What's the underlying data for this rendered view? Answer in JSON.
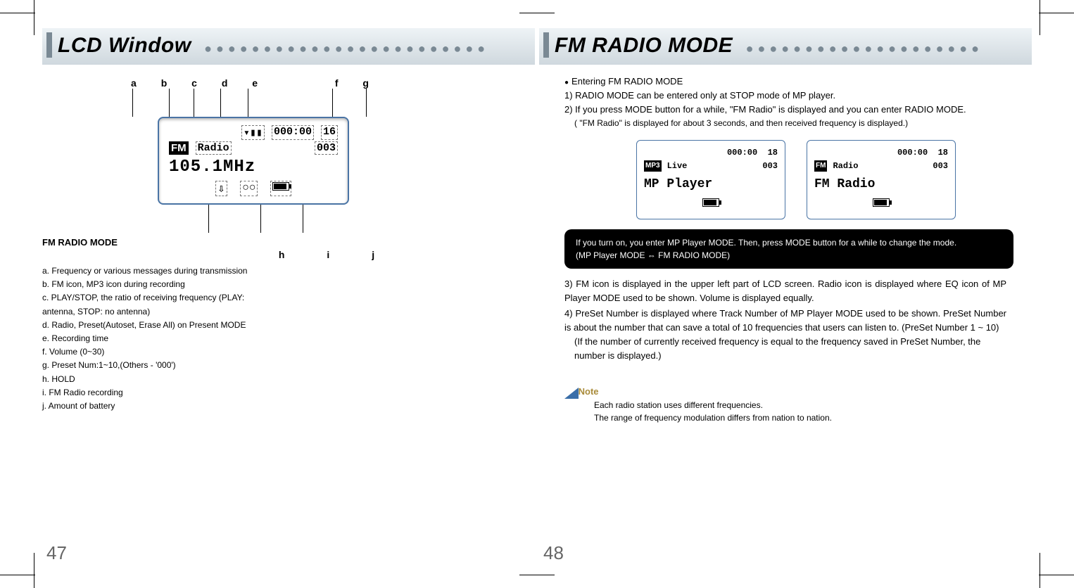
{
  "left": {
    "title": "LCD Window",
    "pageno": "47",
    "labels_top": [
      "a",
      "b",
      "c",
      "d",
      "e",
      "f",
      "g"
    ],
    "labels_bottom": [
      "h",
      "i",
      "j"
    ],
    "lcd": {
      "signal_icon": "▾▮▮",
      "time": "000:00",
      "vol": "16",
      "fm_tag": "FM",
      "radio": "Radio",
      "preset": "003",
      "freq": "105.1MHz",
      "hold_icon": "⇩",
      "rec_icon": "○○",
      "batt_icon": "batt"
    },
    "mode_heading": "FM RADIO MODE",
    "legend": {
      "a": "a. Frequency or various messages during transmission",
      "b": "b. FM icon, MP3 icon during recording",
      "c": "c. PLAY/STOP, the ratio of receiving frequency (PLAY: antenna, STOP: no antenna)",
      "d": "d. Radio, Preset(Autoset, Erase All) on Present MODE",
      "e": "e. Recording time",
      "f": "f.  Volume (0~30)",
      "g": "g. Preset Num:1~10,(Others - '000')",
      "h": "h. HOLD",
      "i": "i.  FM Radio recording",
      "j": "j.  Amount of battery"
    }
  },
  "right": {
    "title": "FM RADIO MODE",
    "pageno": "48",
    "intro_bullet": "Entering FM RADIO MODE",
    "p1": "1) RADIO MODE can be entered only at STOP mode of MP player.",
    "p2": "2) If you press MODE button for a while,  \"FM Radio\" is displayed and you can enter RADIO MODE.",
    "p2_sub": "( \"FM Radio\" is displayed for about 3 seconds, and then received frequency is displayed.)",
    "mini_left": {
      "time": "000:00",
      "vol": "18",
      "tag": "MP3",
      "mode": "Live",
      "preset": "003",
      "big": "MP Player"
    },
    "mini_right": {
      "time": "000:00",
      "vol": "18",
      "tag": "FM",
      "mode": "Radio",
      "preset": "003",
      "big": "FM Radio"
    },
    "blackbox_l1": "If you turn on, you enter MP Player MODE. Then, press MODE button for a while to change the mode.",
    "blackbox_l2": "(MP Player MODE ⇔ FM RADIO MODE)",
    "p3": "3) FM icon is displayed in the upper left part of LCD screen. Radio icon is displayed where EQ icon of MP Player MODE used to be shown. Volume is displayed equally.",
    "p4": "4) PreSet Number is displayed where Track Number of MP Player MODE used to be shown.  PreSet Number is about the number that can save a total of 10 frequencies that users can listen to. (PreSet Number 1 ~ 10)",
    "p4_sub": "(If the number of currently received frequency is equal to the frequency saved in PreSet Number, the number is displayed.)",
    "note_hdr": "Note",
    "note1": "Each radio station uses different frequencies.",
    "note2": "The range of frequency modulation differs from nation to nation."
  }
}
